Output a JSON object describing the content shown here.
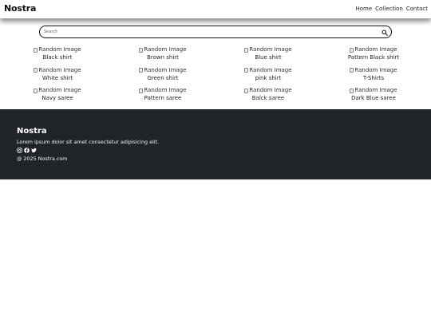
{
  "nav": {
    "brand": "Nostra",
    "links": [
      "Home",
      "Collection",
      "Contact"
    ]
  },
  "search": {
    "placeholder": "Search"
  },
  "products": [
    {
      "img_alt": "Random Image",
      "title": "Black shirt"
    },
    {
      "img_alt": "Random Image",
      "title": "Brown shirt"
    },
    {
      "img_alt": "Random Image",
      "title": "Blue shirt"
    },
    {
      "img_alt": "Random Image",
      "title": "Pattern Black shirt"
    },
    {
      "img_alt": "Random Image",
      "title": "White shirt"
    },
    {
      "img_alt": "Random Image",
      "title": "Green shirt"
    },
    {
      "img_alt": "Random Image",
      "title": "pink shirt"
    },
    {
      "img_alt": "Random Image",
      "title": "T-Shirts"
    },
    {
      "img_alt": "Random Image",
      "title": "Navy saree"
    },
    {
      "img_alt": "Random Image",
      "title": "Pattern saree"
    },
    {
      "img_alt": "Random Image",
      "title": "Balck saree"
    },
    {
      "img_alt": "Random Image",
      "title": "Dark Blue saree"
    }
  ],
  "footer": {
    "brand": "Nostra",
    "description": "Lorem ipsum dolor sit amet consectetur adipisicing elit.",
    "socials": [
      "instagram-icon",
      "facebook-icon",
      "twitter-icon"
    ],
    "copyright": "@ 2025 Nostra.com"
  },
  "colors": {
    "footer_bg": "#212529",
    "text": "#212529",
    "page_bg": "#ffffff"
  }
}
